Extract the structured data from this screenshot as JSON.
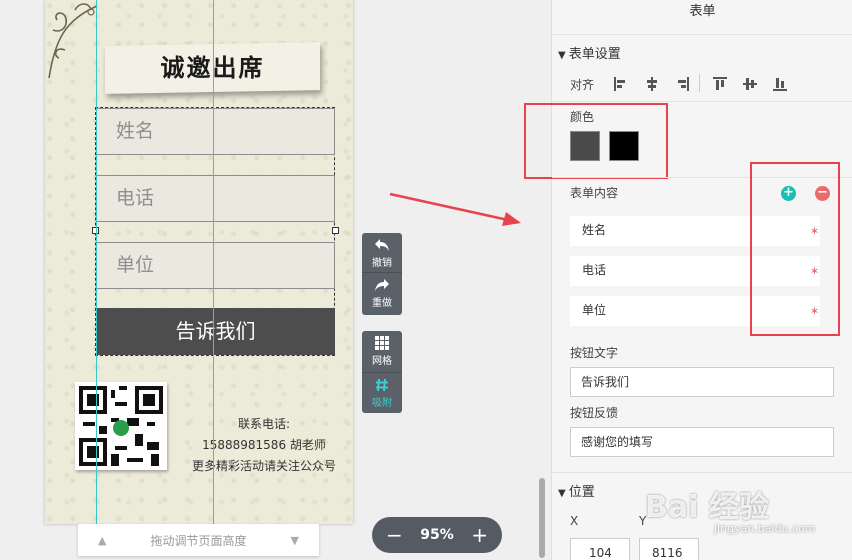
{
  "canvas": {
    "invite_title": "诚邀出席",
    "fields": [
      "姓名",
      "电话",
      "单位"
    ],
    "submit_label": "告诉我们",
    "contact": {
      "label": "联系电话:",
      "phone_line": "15888981586  胡老师",
      "note": "更多精彩活动请关注公众号"
    }
  },
  "page_height_bar": {
    "label": "拖动调节页面高度"
  },
  "tools": {
    "undo": "撤销",
    "redo": "重做",
    "grid": "网格",
    "snap": "吸附"
  },
  "zoom": {
    "minus": "−",
    "value": "95%",
    "plus": "+"
  },
  "panel": {
    "title": "表单",
    "form_settings": {
      "header": "表单设置",
      "align_label": "对齐",
      "color_label": "颜色",
      "colors": [
        "#4a4a4a",
        "#000000"
      ]
    },
    "form_content": {
      "label": "表单内容",
      "items": [
        "姓名",
        "电话",
        "单位"
      ],
      "required_mark": "*"
    },
    "button_text": {
      "label": "按钮文字",
      "value": "告诉我们"
    },
    "button_feedback": {
      "label": "按钮反馈",
      "value": "感谢您的填写"
    },
    "position": {
      "header": "位置",
      "x_label": "X",
      "y_label": "Y",
      "x_value": "104",
      "y_value": "8116"
    }
  },
  "watermark": {
    "main": "Bai 经验",
    "sub": "jingyan.baidu.com"
  },
  "accent_colors": {
    "highlight": "#e8424e",
    "guide": "#39c8c8",
    "teal": "#19c0b0"
  }
}
